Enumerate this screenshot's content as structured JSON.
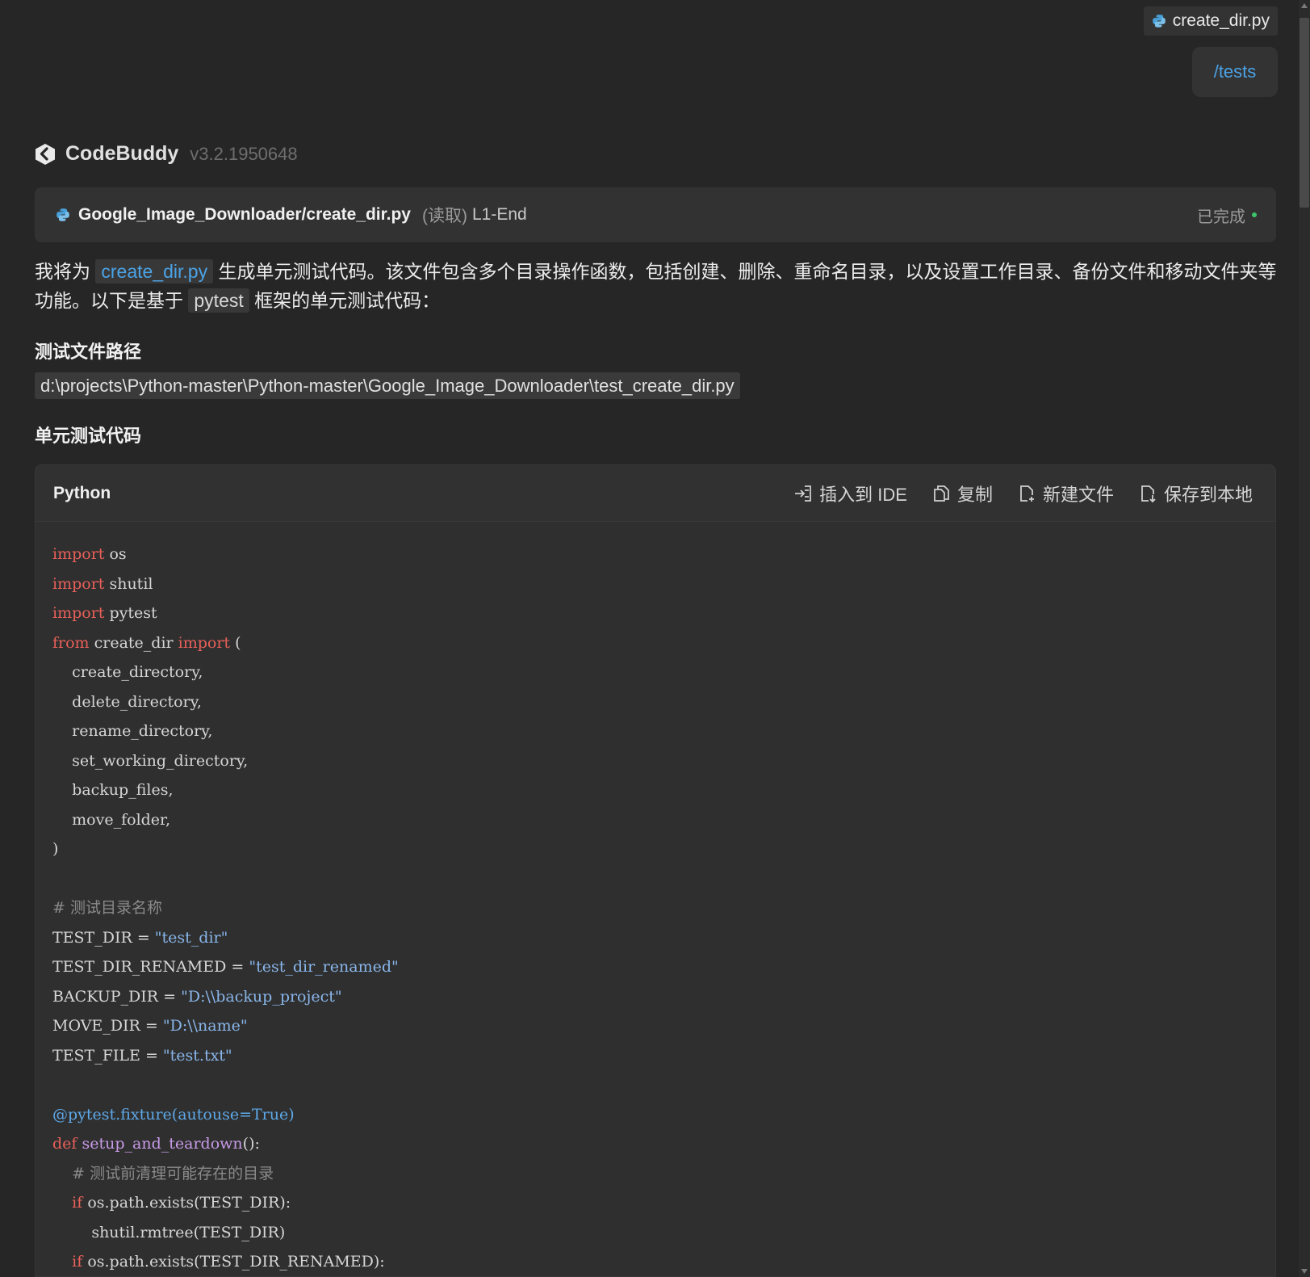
{
  "attached_file": {
    "name": "create_dir.py"
  },
  "user_message": {
    "text": "/tests"
  },
  "assistant": {
    "name": "CodeBuddy",
    "version": "v3.2.1950648"
  },
  "read_step": {
    "path": "Google_Image_Downloader/create_dir.py",
    "mode": "(读取)",
    "range": "L1-End",
    "status": "已完成"
  },
  "intro": {
    "p1": "我将为",
    "file_link": "create_dir.py",
    "p2": "生成单元测试代码。该文件包含多个目录操作函数，包括创建、删除、重命名目录，以及设置工作目录、备份文件和移动文件夹等功能。以下是基于",
    "framework": "pytest",
    "p3": "框架的单元测试代码："
  },
  "sections": {
    "path_heading": "测试文件路径",
    "test_path": "d:\\projects\\Python-master\\Python-master\\Google_Image_Downloader\\test_create_dir.py",
    "code_heading": "单元测试代码"
  },
  "code_block": {
    "language": "Python",
    "actions": {
      "insert": "插入到 IDE",
      "copy": "复制",
      "new_file": "新建文件",
      "save": "保存到本地"
    },
    "lines": [
      [
        {
          "t": "kw",
          "v": "import"
        },
        {
          "t": "",
          "v": " os"
        }
      ],
      [
        {
          "t": "kw",
          "v": "import"
        },
        {
          "t": "",
          "v": " shutil"
        }
      ],
      [
        {
          "t": "kw",
          "v": "import"
        },
        {
          "t": "",
          "v": " pytest"
        }
      ],
      [
        {
          "t": "kw",
          "v": "from"
        },
        {
          "t": "",
          "v": " create_dir "
        },
        {
          "t": "kw",
          "v": "import"
        },
        {
          "t": "",
          "v": " ("
        }
      ],
      [
        {
          "t": "",
          "v": "    create_directory,"
        }
      ],
      [
        {
          "t": "",
          "v": "    delete_directory,"
        }
      ],
      [
        {
          "t": "",
          "v": "    rename_directory,"
        }
      ],
      [
        {
          "t": "",
          "v": "    set_working_directory,"
        }
      ],
      [
        {
          "t": "",
          "v": "    backup_files,"
        }
      ],
      [
        {
          "t": "",
          "v": "    move_folder,"
        }
      ],
      [
        {
          "t": "",
          "v": ")"
        }
      ],
      [],
      [
        {
          "t": "cmt",
          "v": "# 测试目录名称"
        }
      ],
      [
        {
          "t": "",
          "v": "TEST_DIR = "
        },
        {
          "t": "str",
          "v": "\"test_dir\""
        }
      ],
      [
        {
          "t": "",
          "v": "TEST_DIR_RENAMED = "
        },
        {
          "t": "str",
          "v": "\"test_dir_renamed\""
        }
      ],
      [
        {
          "t": "",
          "v": "BACKUP_DIR = "
        },
        {
          "t": "str",
          "v": "\"D:\\\\backup_project\""
        }
      ],
      [
        {
          "t": "",
          "v": "MOVE_DIR = "
        },
        {
          "t": "str",
          "v": "\"D:\\\\name\""
        }
      ],
      [
        {
          "t": "",
          "v": "TEST_FILE = "
        },
        {
          "t": "str",
          "v": "\"test.txt\""
        }
      ],
      [],
      [
        {
          "t": "dec",
          "v": "@pytest.fixture(autouse=True)"
        }
      ],
      [
        {
          "t": "kw",
          "v": "def"
        },
        {
          "t": "",
          "v": " "
        },
        {
          "t": "fn",
          "v": "setup_and_teardown"
        },
        {
          "t": "",
          "v": "():"
        }
      ],
      [
        {
          "t": "cmt",
          "v": "    # 测试前清理可能存在的目录"
        }
      ],
      [
        {
          "t": "",
          "v": "    "
        },
        {
          "t": "kw",
          "v": "if"
        },
        {
          "t": "",
          "v": " os.path.exists(TEST_DIR):"
        }
      ],
      [
        {
          "t": "",
          "v": "        shutil.rmtree(TEST_DIR)"
        }
      ],
      [
        {
          "t": "",
          "v": "    "
        },
        {
          "t": "kw",
          "v": "if"
        },
        {
          "t": "",
          "v": " os.path.exists(TEST_DIR_RENAMED):"
        }
      ]
    ]
  }
}
